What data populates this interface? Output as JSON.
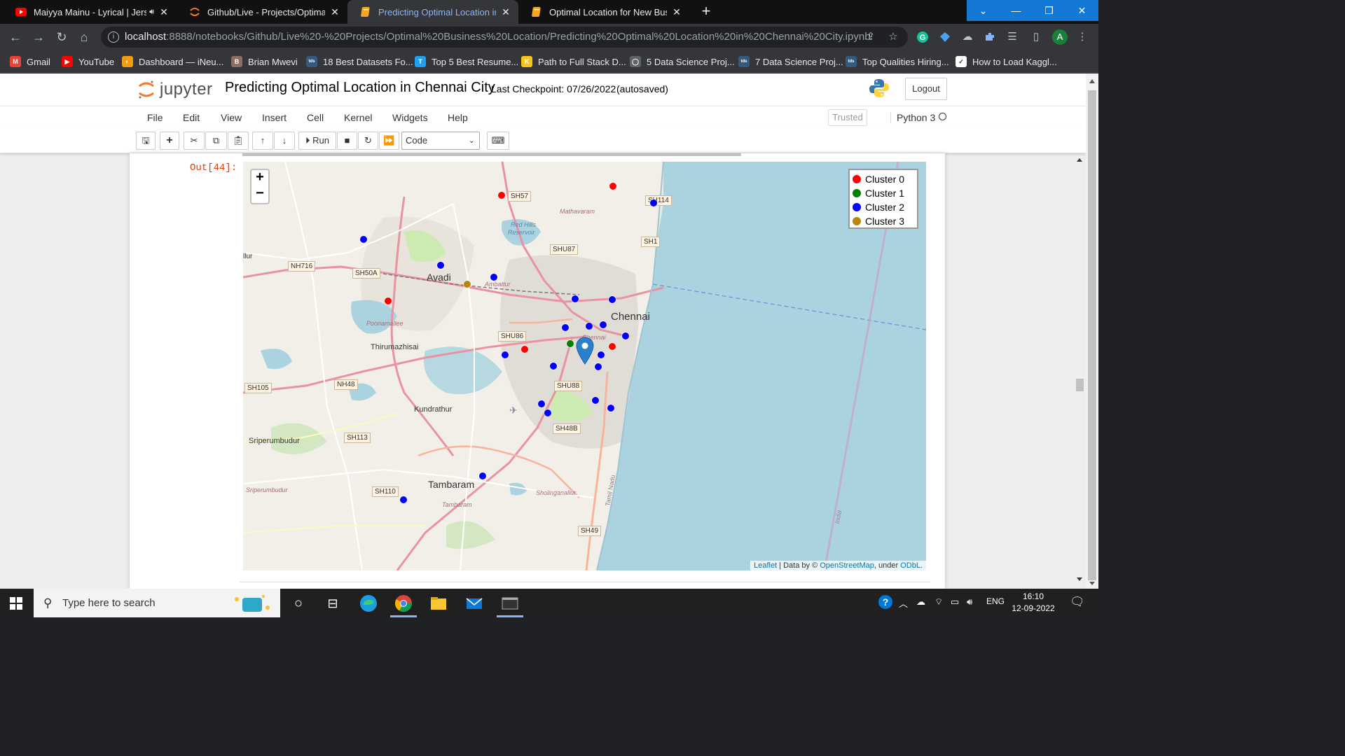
{
  "browser": {
    "tabs": [
      {
        "title": "Maiyya Mainu - Lyrical | Jerse",
        "icon": "youtube-icon",
        "active": false,
        "sound": true
      },
      {
        "title": "Github/Live - Projects/Optimal B",
        "icon": "jupyter-icon",
        "active": false
      },
      {
        "title": "Predicting Optimal Location in C",
        "icon": "notebook-icon",
        "active": true
      },
      {
        "title": "Optimal Location for New Busine",
        "icon": "notebook-icon",
        "active": false
      }
    ],
    "url_host": "localhost",
    "url_path": ":8888/notebooks/Github/Live%20-%20Projects/Optimal%20Business%20Location/Predicting%20Optimal%20Location%20in%20Chennai%20City.ipynb",
    "profile_initial": "A",
    "bookmarks": [
      {
        "label": "Gmail",
        "icon": "gmail-icon",
        "color": "#ea4335",
        "glyph": "M"
      },
      {
        "label": "YouTube",
        "icon": "youtube-icon",
        "color": "#ff0000",
        "glyph": "▶"
      },
      {
        "label": "Dashboard — iNeu...",
        "icon": "ineuron-icon",
        "color": "#f39c12",
        "glyph": "◐"
      },
      {
        "label": "Brian Mwevi",
        "icon": "person-icon",
        "color": "#8d6e63",
        "glyph": "B"
      },
      {
        "label": "18 Best Datasets Fo...",
        "icon": "tds-icon",
        "color": "#355a80",
        "glyph": "tds"
      },
      {
        "label": "Top 5 Best Resume...",
        "icon": "t-icon",
        "color": "#1da1f2",
        "glyph": "T"
      },
      {
        "label": "Path to Full Stack D...",
        "icon": "k-icon",
        "color": "#f5c518",
        "glyph": "K"
      },
      {
        "label": "5 Data Science Proj...",
        "icon": "globe-icon",
        "color": "#5f6368",
        "glyph": "◯"
      },
      {
        "label": "7 Data Science Proj...",
        "icon": "tds-icon",
        "color": "#355a80",
        "glyph": "tds"
      },
      {
        "label": "Top Qualities Hiring...",
        "icon": "tds-icon",
        "color": "#355a80",
        "glyph": "tds"
      },
      {
        "label": "How to Load Kaggl...",
        "icon": "doc-icon",
        "color": "#ffffff",
        "glyph": "✓"
      }
    ]
  },
  "jupyter": {
    "logo_text": "jupyter",
    "notebook_title": "Predicting Optimal Location in Chennai City",
    "checkpoint": "Last Checkpoint: 07/26/2022",
    "autosaved": "(autosaved)",
    "logout": "Logout",
    "menus": [
      "File",
      "Edit",
      "View",
      "Insert",
      "Cell",
      "Kernel",
      "Widgets",
      "Help"
    ],
    "trusted": "Trusted",
    "kernel": "Python 3",
    "run_label": "Run",
    "cell_type": "Code",
    "out_prompt": "Out[44]:"
  },
  "map": {
    "zoom_in": "+",
    "zoom_out": "−",
    "legend": [
      {
        "label": "Cluster 0",
        "color": "#ff0000"
      },
      {
        "label": "Cluster 1",
        "color": "#008000"
      },
      {
        "label": "Cluster 2",
        "color": "#0000ff"
      },
      {
        "label": "Cluster 3",
        "color": "#b8860b"
      }
    ],
    "attribution_leaflet": "Leaflet",
    "attribution_mid": " | Data by © ",
    "attribution_osm": "OpenStreetMap",
    "attribution_under": ", under ",
    "attribution_odbl": "ODbL.",
    "labels": {
      "chennai": "Chennai",
      "avadi": "Avadi",
      "thirumazhisai": "Thirumazhisai",
      "kundrathur": "Kundrathur",
      "sriperumbudur": "Sriperumbudur",
      "sriperumbudur_small": "Sriperumbudur",
      "tambaram": "Tambaram",
      "tambaram_small": "Tambaram",
      "poonamallee": "Poonamallee",
      "mathavaram": "Mathavaram",
      "redhills": "Red Hills",
      "reservoir": "Reservoir",
      "ambattur": "Ambattur",
      "sholinganallur": "Sholinganallur",
      "chennai_small": "Chennai",
      "tamilnadu": "Tamil Nadu",
      "india": "India",
      "llur": "llur",
      "sh57": "SH57",
      "sh114": "SH114",
      "sh1": "SH1",
      "shu87": "SHU87",
      "nh716": "NH716",
      "sh50a": "SH50A",
      "shu86": "SHU86",
      "nh48": "NH48",
      "sh105": "SH105",
      "shu88": "SHU88",
      "sh48b": "SH48B",
      "sh113": "SH113",
      "sh110": "SH110",
      "sh49": "SH49"
    }
  },
  "taskbar": {
    "search_placeholder": "Type here to search",
    "language": "ENG",
    "time": "16:10",
    "date": "12-09-2022"
  }
}
